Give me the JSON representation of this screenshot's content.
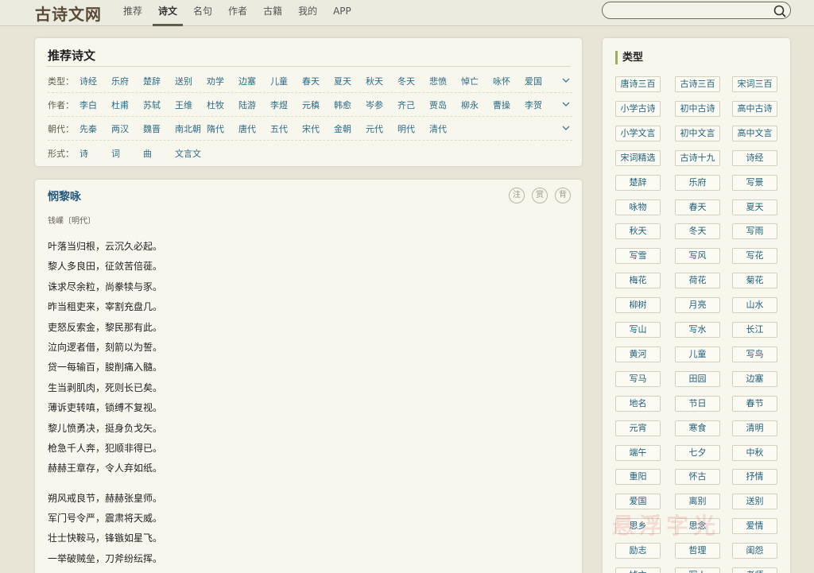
{
  "header": {
    "logo": "古诗文网",
    "nav": [
      "推荐",
      "诗文",
      "名句",
      "作者",
      "古籍",
      "我的",
      "APP"
    ],
    "active_nav": "诗文",
    "search_placeholder": ""
  },
  "recommend": {
    "title": "推荐诗文",
    "rows": [
      {
        "label": "类型：",
        "items": [
          "诗经",
          "乐府",
          "楚辞",
          "送别",
          "劝学",
          "边塞",
          "儿童",
          "春天",
          "夏天",
          "秋天",
          "冬天",
          "悲愤",
          "悼亡",
          "咏怀",
          "爱国"
        ],
        "expandable": true
      },
      {
        "label": "作者：",
        "items": [
          "李白",
          "杜甫",
          "苏轼",
          "王维",
          "杜牧",
          "陆游",
          "李煜",
          "元稹",
          "韩愈",
          "岑参",
          "齐己",
          "贾岛",
          "柳永",
          "曹操",
          "李贺"
        ],
        "expandable": true
      },
      {
        "label": "朝代：",
        "items": [
          "先秦",
          "两汉",
          "魏晋",
          "南北朝",
          "隋代",
          "唐代",
          "五代",
          "宋代",
          "金朝",
          "元代",
          "明代",
          "清代"
        ],
        "expandable": true
      },
      {
        "label": "形式：",
        "items": [
          "诗",
          "词",
          "曲",
          "文言文"
        ],
        "expandable": false
      }
    ]
  },
  "poem": {
    "title": "悯黎咏",
    "author": "钱嶫〔明代〕",
    "tools": [
      "注",
      "赏",
      "背"
    ],
    "stanzas": [
      [
        "叶落当归根，云沉久必起。",
        "黎人多良田，征敛苦倍蓰。",
        "诛求尽余粒，尚豢犊与豕。",
        "昨当租吏来，宰割充盘几。",
        "吏怒反索金，黎民那有此。",
        "泣向逻者借，刻箭以为誓。",
        "贷一每输百，朘削痛入髓。",
        "生当剥肌肉，死则长已矣。",
        "薄诉吏转嗔，锁缚不复视。",
        "黎儿愤勇决，挺身负戈矢。",
        "枪急千人奔，犯顺非得已。",
        "赫赫王章存，令人弃如纸。"
      ],
      [
        "朔风戒良节，赫赫张皇师。",
        "军门号令严，震肃将天威。",
        "壮士快鞍马，锋镞如星飞。",
        "一举破贼垒，刀斧纷纭挥。"
      ]
    ]
  },
  "sidebar": {
    "title": "类型",
    "tags": [
      "唐诗三百",
      "古诗三百",
      "宋词三百",
      "小学古诗",
      "初中古诗",
      "高中古诗",
      "小学文言",
      "初中文言",
      "高中文言",
      "宋词精选",
      "古诗十九",
      "诗经",
      "楚辞",
      "乐府",
      "写景",
      "咏物",
      "春天",
      "夏天",
      "秋天",
      "冬天",
      "写雨",
      "写雪",
      "写风",
      "写花",
      "梅花",
      "荷花",
      "菊花",
      "柳树",
      "月亮",
      "山水",
      "写山",
      "写水",
      "长江",
      "黄河",
      "儿童",
      "写鸟",
      "写马",
      "田园",
      "边塞",
      "地名",
      "节日",
      "春节",
      "元宵",
      "寒食",
      "清明",
      "端午",
      "七夕",
      "中秋",
      "重阳",
      "怀古",
      "抒情",
      "爱国",
      "离别",
      "送别",
      "思乡",
      "思念",
      "爱情",
      "励志",
      "哲理",
      "闺怨",
      "悼亡",
      "写人",
      "老师"
    ]
  },
  "colors": {
    "link": "#2c6a82",
    "title": "#23577a",
    "accent_bar": "#99b060",
    "background": "#e8e5d7",
    "card": "#f8f7ee"
  },
  "icons": {
    "search": "search-icon",
    "expand": "chevron-down-icon"
  }
}
